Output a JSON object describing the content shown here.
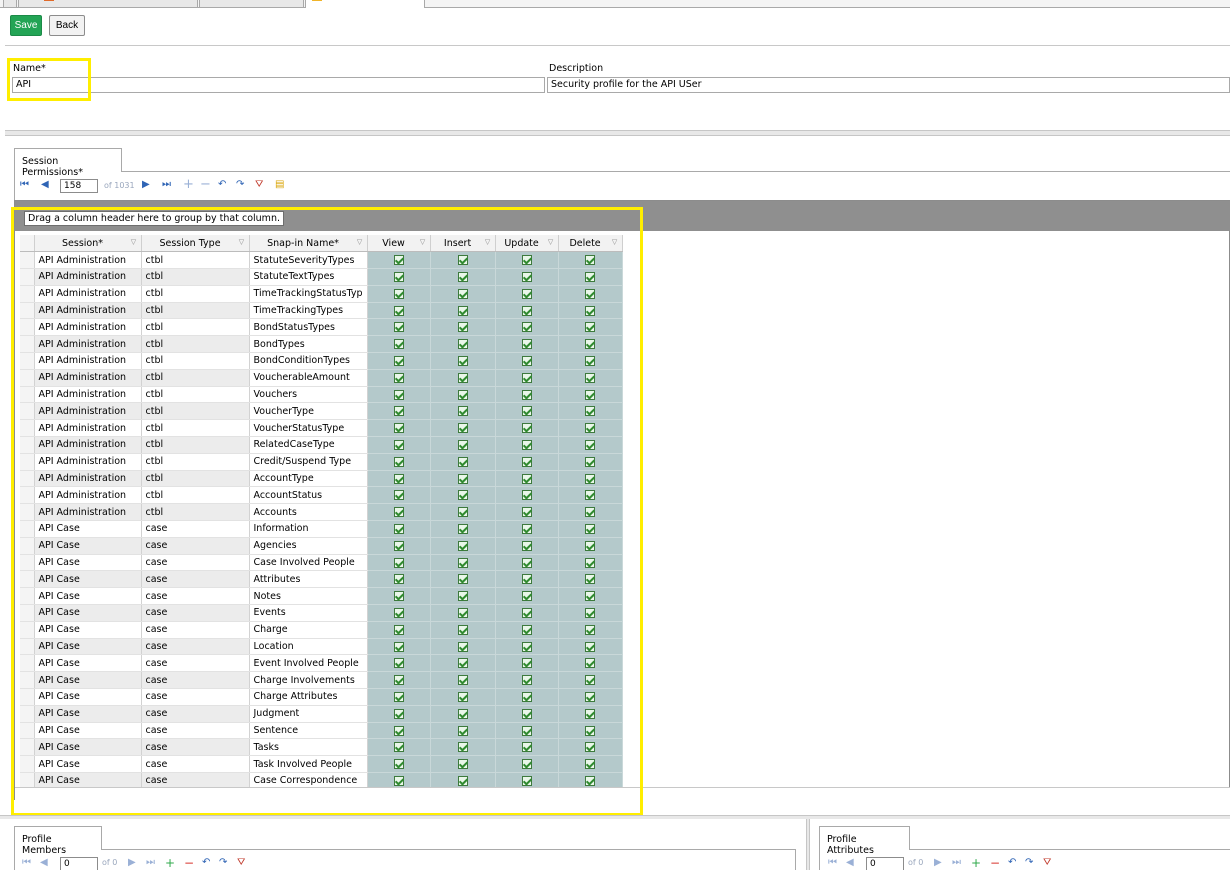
{
  "toolbar": {
    "save_label": "Save",
    "back_label": "Back"
  },
  "form": {
    "name_label": "Name*",
    "name_value": "API",
    "description_label": "Description",
    "description_value": "Security profile for the API USer"
  },
  "session_section": {
    "tab_label": "Session Permissions*",
    "nav": {
      "current_page": "158",
      "of_text": "of 1031"
    },
    "group_hint": "Drag a column header here to group by that column.",
    "columns": [
      "Session*",
      "Session Type",
      "Snap-in Name*",
      "View",
      "Insert",
      "Update",
      "Delete"
    ],
    "rows": [
      {
        "session": "API Administration",
        "type": "ctbl",
        "snapin": "StatuteSeverityTypes"
      },
      {
        "session": "API Administration",
        "type": "ctbl",
        "snapin": "StatuteTextTypes"
      },
      {
        "session": "API Administration",
        "type": "ctbl",
        "snapin": "TimeTrackingStatusTyp"
      },
      {
        "session": "API Administration",
        "type": "ctbl",
        "snapin": "TimeTrackingTypes"
      },
      {
        "session": "API Administration",
        "type": "ctbl",
        "snapin": "BondStatusTypes"
      },
      {
        "session": "API Administration",
        "type": "ctbl",
        "snapin": "BondTypes"
      },
      {
        "session": "API Administration",
        "type": "ctbl",
        "snapin": "BondConditionTypes"
      },
      {
        "session": "API Administration",
        "type": "ctbl",
        "snapin": "VoucherableAmount"
      },
      {
        "session": "API Administration",
        "type": "ctbl",
        "snapin": "Vouchers"
      },
      {
        "session": "API Administration",
        "type": "ctbl",
        "snapin": "VoucherType"
      },
      {
        "session": "API Administration",
        "type": "ctbl",
        "snapin": "VoucherStatusType"
      },
      {
        "session": "API Administration",
        "type": "ctbl",
        "snapin": "RelatedCaseType"
      },
      {
        "session": "API Administration",
        "type": "ctbl",
        "snapin": "Credit/Suspend Type"
      },
      {
        "session": "API Administration",
        "type": "ctbl",
        "snapin": "AccountType"
      },
      {
        "session": "API Administration",
        "type": "ctbl",
        "snapin": "AccountStatus"
      },
      {
        "session": "API Administration",
        "type": "ctbl",
        "snapin": "Accounts"
      },
      {
        "session": "API Case",
        "type": "case",
        "snapin": "Information"
      },
      {
        "session": "API Case",
        "type": "case",
        "snapin": "Agencies"
      },
      {
        "session": "API Case",
        "type": "case",
        "snapin": "Case Involved People"
      },
      {
        "session": "API Case",
        "type": "case",
        "snapin": "Attributes"
      },
      {
        "session": "API Case",
        "type": "case",
        "snapin": "Notes"
      },
      {
        "session": "API Case",
        "type": "case",
        "snapin": "Events"
      },
      {
        "session": "API Case",
        "type": "case",
        "snapin": "Charge"
      },
      {
        "session": "API Case",
        "type": "case",
        "snapin": "Location"
      },
      {
        "session": "API Case",
        "type": "case",
        "snapin": "Event Involved People"
      },
      {
        "session": "API Case",
        "type": "case",
        "snapin": "Charge Involvements"
      },
      {
        "session": "API Case",
        "type": "case",
        "snapin": "Charge Attributes"
      },
      {
        "session": "API Case",
        "type": "case",
        "snapin": "Judgment"
      },
      {
        "session": "API Case",
        "type": "case",
        "snapin": "Sentence"
      },
      {
        "session": "API Case",
        "type": "case",
        "snapin": "Tasks"
      },
      {
        "session": "API Case",
        "type": "case",
        "snapin": "Task Involved People"
      },
      {
        "session": "API Case",
        "type": "case",
        "snapin": "Case Correspondence"
      }
    ]
  },
  "profile_members": {
    "tab_label": "Profile Members",
    "page": "0",
    "of_text": "of 0"
  },
  "profile_attributes": {
    "tab_label": "Profile Attributes",
    "page": "0",
    "of_text": "of 0"
  },
  "colors": {
    "save_green": "#23a455",
    "highlight_yellow": "#ffee00",
    "checkbox_column_bg": "#b4c9cb",
    "group_bar_gray": "#8f8f8f"
  }
}
